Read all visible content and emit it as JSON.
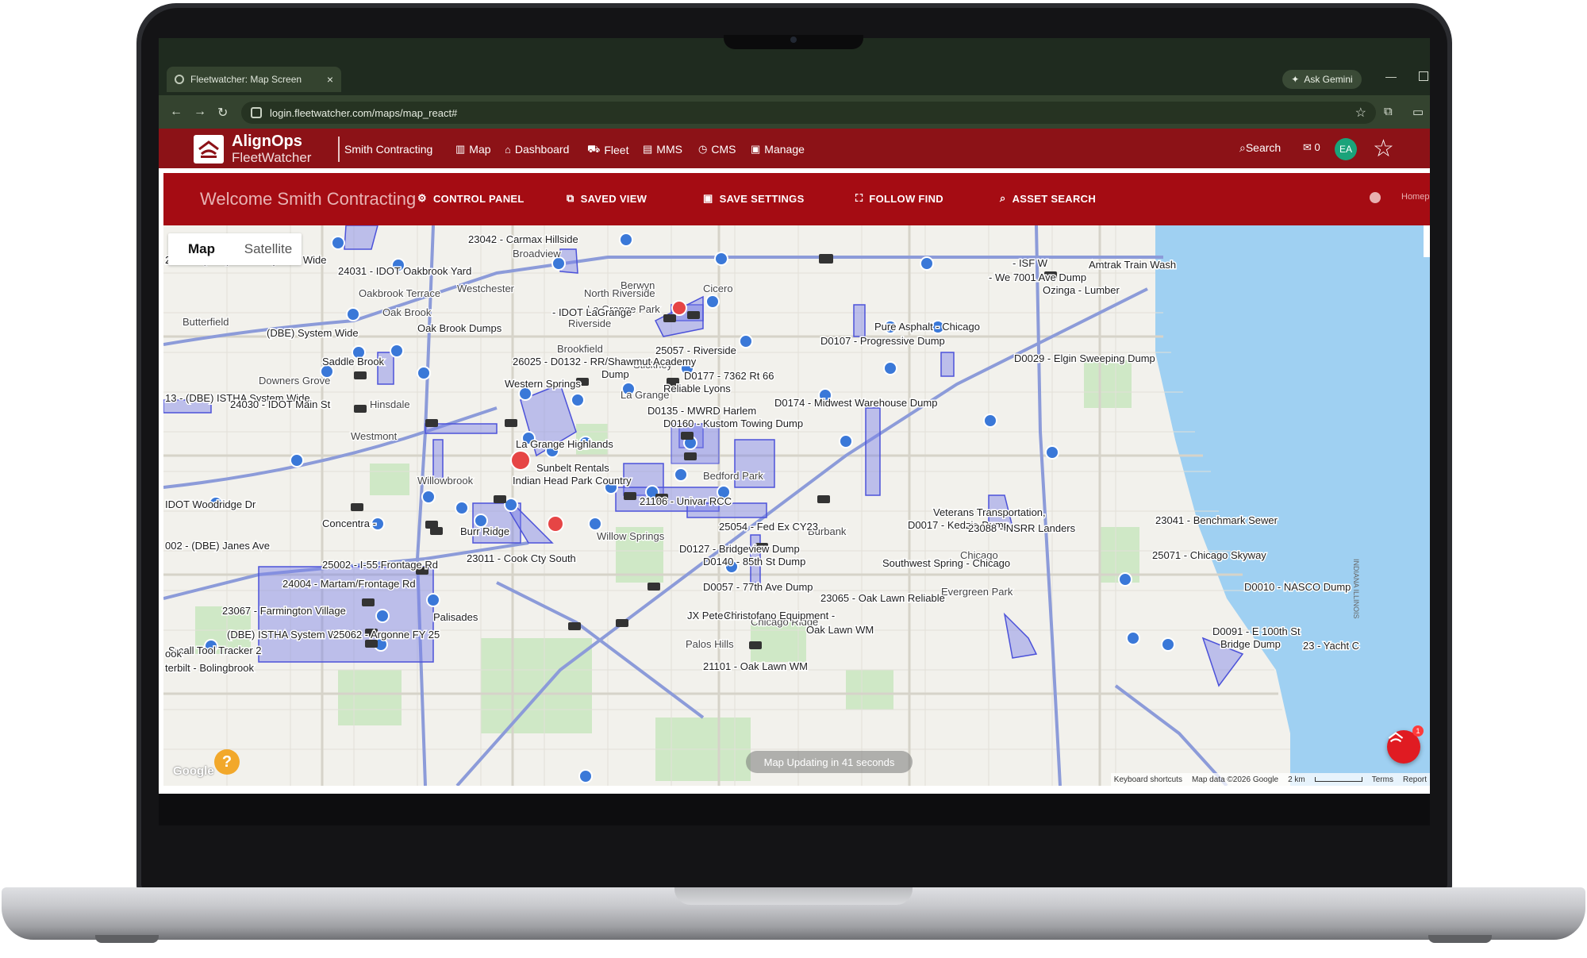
{
  "browser": {
    "tab_title": "Fleetwatcher: Map Screen",
    "tab_close": "×",
    "url": "login.fleetwatcher.com/maps/map_react#",
    "ask_gemini": "Ask Gemini"
  },
  "app": {
    "brand_line1": "AlignOps",
    "brand_line2": "FleetWatcher",
    "company": "Smith Contracting",
    "nav": [
      "Map",
      "Dashboard",
      "Fleet",
      "MMS",
      "CMS",
      "Manage"
    ],
    "search_label": "Search",
    "message_count": "0",
    "avatar_initials": "EA",
    "brand_color": "#8c1217"
  },
  "control_bar": {
    "welcome": "Welcome Smith Contracting",
    "control_panel": "CONTROL PANEL",
    "saved_view": "SAVED VIEW",
    "save_settings": "SAVE SETTINGS",
    "follow_find": "FOLLOW FIND",
    "asset_search": "ASSET SEARCH",
    "home_label": "Homep",
    "bar_color": "#a50c13"
  },
  "map": {
    "toggle_map": "Map",
    "toggle_satellite": "Satellite",
    "update_status": "Map Updating in 41 seconds",
    "google_mark": "Google",
    "attribution": [
      "Keyboard shortcuts",
      "Map data ©2026 Google",
      "2 km",
      "Terms",
      "Report"
    ],
    "help_label": "?",
    "fab_badge": "1",
    "towns": [
      "Broadview",
      "Westchester",
      "Berwyn",
      "Cicero",
      "North Riverside",
      "Riverside",
      "La Grange Park",
      "Brookfield",
      "Stickney",
      "Westmont",
      "Hinsdale",
      "Willowbrook",
      "Burbank",
      "Evergreen Park",
      "Bedford Park",
      "Willow Springs",
      "Palos Hills",
      "Downers Grove",
      "Butterfield",
      "Oak Brook",
      "La Grange",
      "Chicago Ridge",
      "Chicago",
      "Oakbrook Terrace"
    ],
    "geofences": [
      "23042 - Carmax Hillside",
      "24113 - (DBE) ISTHA System Wide",
      "24031 - IDOT Oakbrook Yard",
      "- IDOT LaGrange",
      "Oak Brook Dumps",
      "(DBE) System Wide",
      "Saddle Brook",
      "26025 - D0132 - RR/Shawmut Academy",
      "Dump",
      "25057 - Riverside",
      "Reliable Lyons",
      "D0177 - 7362 Rt 66",
      "Pure Asphalt - Chicago",
      "D0107 - Progressive Dump",
      "D0029 - Elgin Sweeping Dump",
      "Amtrak Train Wash",
      "Ozinga - Lumber",
      "Western Springs",
      "13 - (DBE) ISTHA System Wide",
      "24030 - IDOT Main St",
      "D0135 - MWRD Harlem",
      "D0174 - Midwest Warehouse Dump",
      "D0160 - Kustom Towing Dump",
      "La Grange Highlands",
      "Sunbelt Rentals",
      "Indian Head Park Country",
      "21106 - Univar RCC",
      "IDOT Woodridge Dr",
      "Concentra -",
      "002 - (DBE) Janes Ave",
      "Burr Ridge",
      "25054 - Fed Ex CY23",
      "23011 - Cook Cty South",
      "D0127 - Bridgeview Dump",
      "D0140 - 85th St Dump",
      "25002 - I-55 Frontage Rd",
      "24004 - Martam/Frontage Rd",
      "D0057 - 77th Ave Dump",
      "23065 - Oak Lawn Reliable",
      "23067 - Farmington Village",
      "(DBE) ISTHA System Wide",
      "25062 - Argonne FY 25",
      "JX Peterbilt",
      "Christofano Equipment -",
      "Oak Lawn WM",
      "Veterans Transportation,",
      "D0017 - Kedzie Dump",
      "23088 - NSRR Landers",
      "Southwest Spring - Chicago",
      "23041 - Benchmark Sewer",
      "25071 - Chicago Skyway",
      "D0010 - NASCO Dump",
      "D0091 - E 100th St",
      "Bridge Dump",
      "23 - Yacht C",
      "Small Tool Tracker 2",
      "21101 - Oak Lawn WM",
      "terbilt - Bolingbrook",
      "ook",
      "Palisades",
      "- We 7001 Ave Dump",
      "- ISF W"
    ]
  }
}
